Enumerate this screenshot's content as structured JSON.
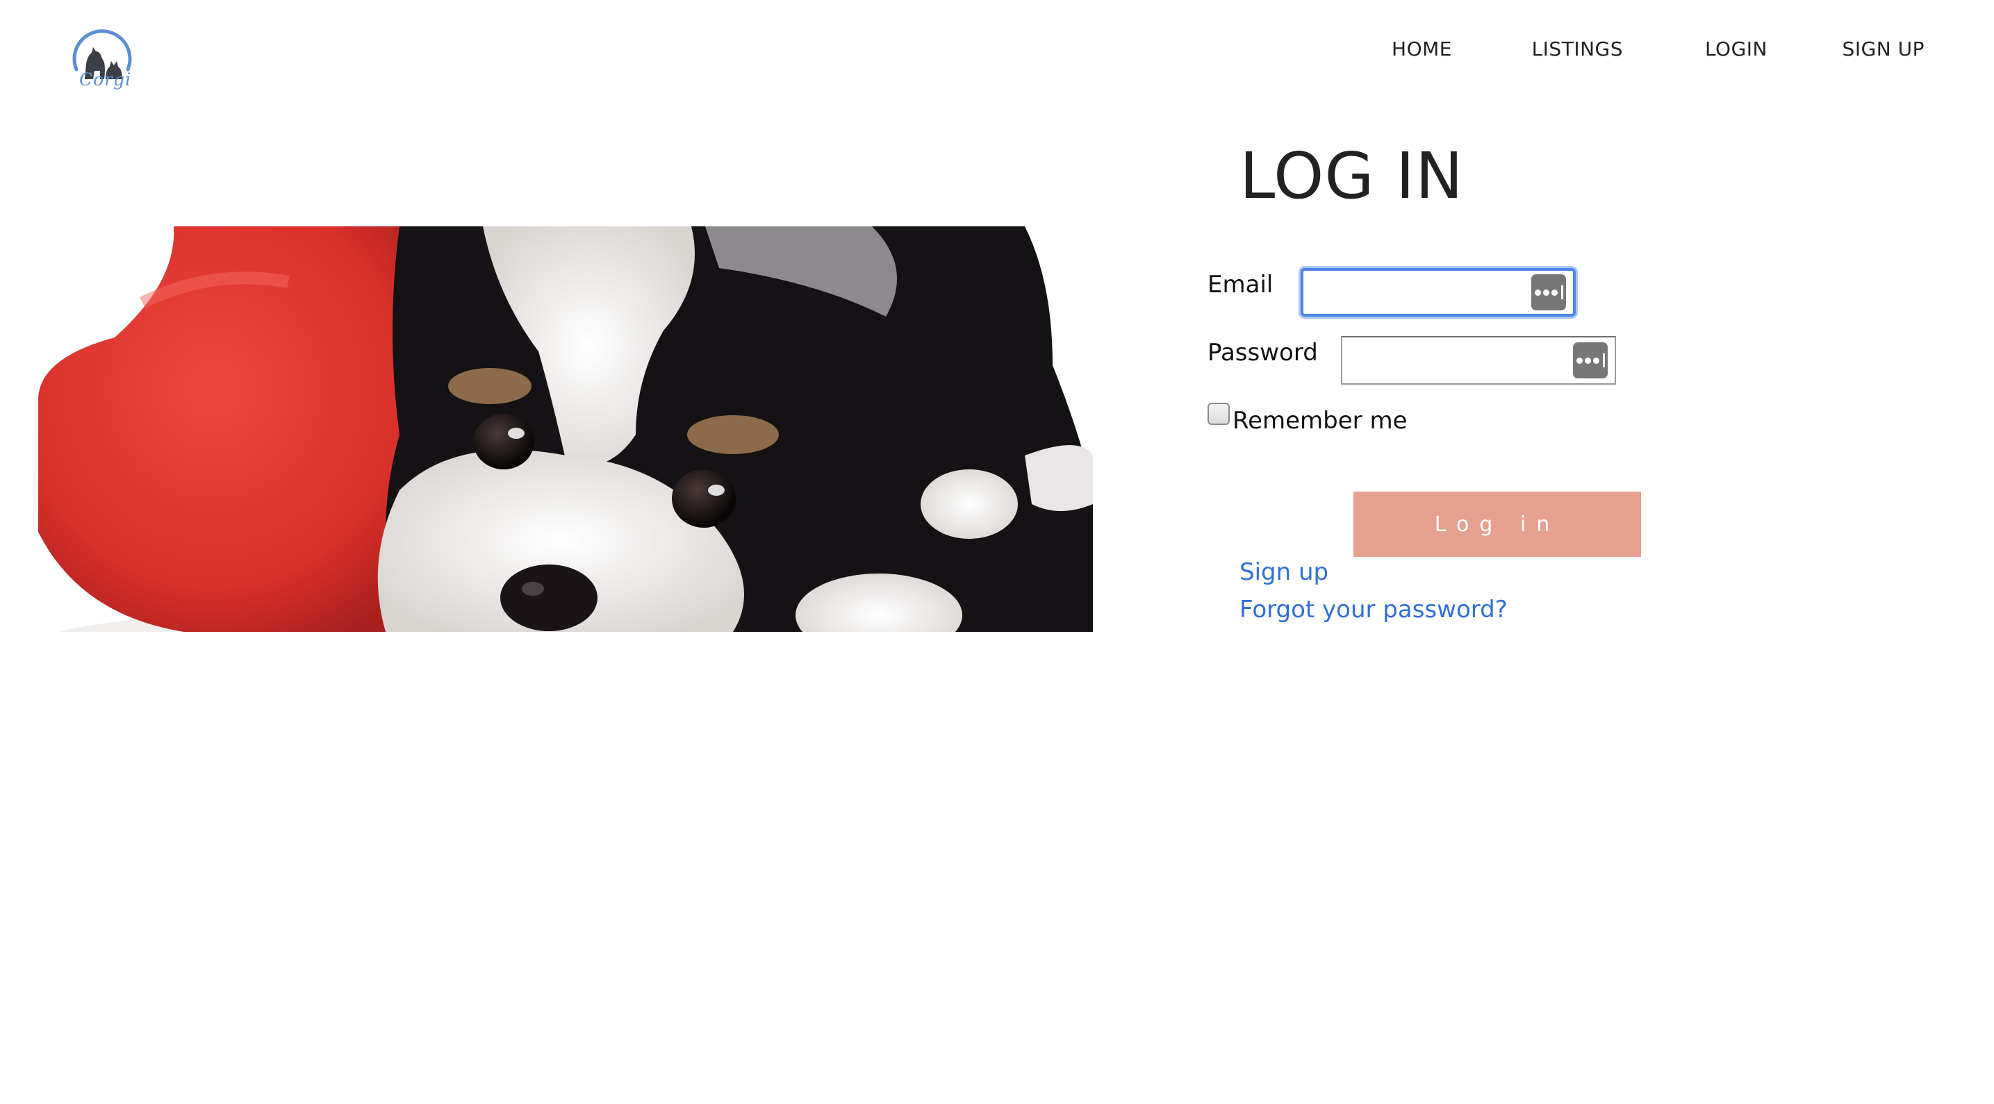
{
  "logo": {
    "text": "Corgi",
    "brand_color": "#5b8fd4"
  },
  "nav": {
    "items": [
      {
        "label": "HOME"
      },
      {
        "label": "LISTINGS"
      },
      {
        "label": "LOGIN"
      },
      {
        "label": "SIGN UP"
      }
    ]
  },
  "hero": {
    "subject": "puppy-with-red-heart-pillow"
  },
  "form": {
    "title": "LOG IN",
    "email": {
      "label": "Email",
      "value": "",
      "icon": "password-manager-key-icon",
      "focused": true
    },
    "password": {
      "label": "Password",
      "value": "",
      "icon": "password-manager-key-icon"
    },
    "remember": {
      "label": "Remember me",
      "checked": false
    },
    "submit": {
      "label": "Log in"
    },
    "links": {
      "signup": "Sign up",
      "forgot": "Forgot your password?"
    }
  },
  "colors": {
    "button": "#e6a090",
    "link": "#2f6fd6",
    "focus_ring": "#4a86e8"
  }
}
